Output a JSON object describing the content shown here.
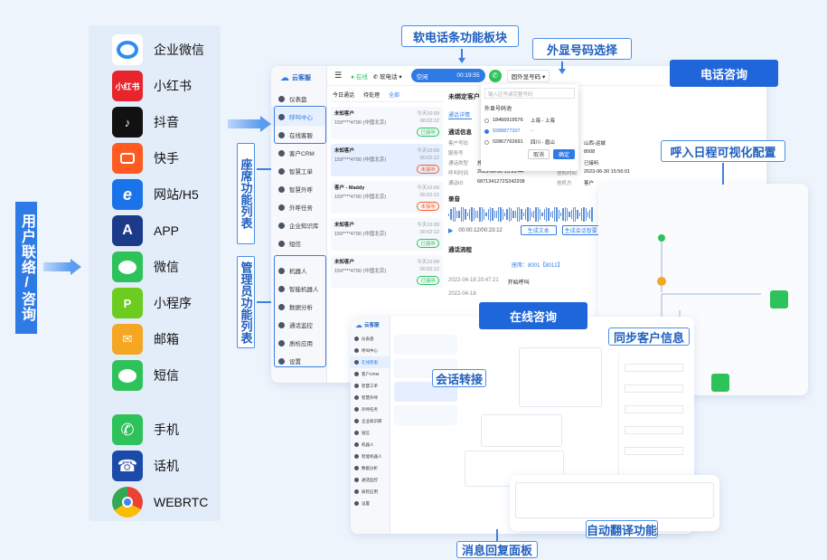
{
  "left_label": "用户联络/咨询",
  "channels": [
    {
      "name": "企业微信",
      "icon": "wecom-icon",
      "color": "#2d8cf0"
    },
    {
      "name": "小红书",
      "icon": "xiaohongshu-icon",
      "color": "#e8242c",
      "icon_text": "小红书"
    },
    {
      "name": "抖音",
      "icon": "douyin-icon",
      "color": "#111111",
      "icon_text": "♪"
    },
    {
      "name": "快手",
      "icon": "kuaishou-icon",
      "color": "#ff5a1f"
    },
    {
      "name": "网站/H5",
      "icon": "browser-e-icon",
      "color": "#1a73e8",
      "icon_text": "e"
    },
    {
      "name": "APP",
      "icon": "app-store-icon",
      "color": "#1b3a8a",
      "icon_text": "A"
    },
    {
      "name": "微信",
      "icon": "wechat-icon",
      "color": "#2ec35a"
    },
    {
      "name": "小程序",
      "icon": "miniprogram-icon",
      "color": "#6ccc1f",
      "icon_text": "P"
    },
    {
      "name": "邮箱",
      "icon": "mail-icon",
      "color": "#f5a623",
      "icon_text": "✉"
    },
    {
      "name": "短信",
      "icon": "sms-icon",
      "color": "#2ec35a"
    },
    {
      "name": "手机",
      "icon": "phone-icon",
      "color": "#2ec35a",
      "icon_text": "✆"
    },
    {
      "name": "话机",
      "icon": "desk-phone-icon",
      "color": "#1b4aa8",
      "icon_text": "☎"
    },
    {
      "name": "WEBRTC",
      "icon": "chrome-icon",
      "color": "#ffffff"
    }
  ],
  "seat_label": "座席功能列表",
  "admin_label": "管理员功能列表",
  "callouts": {
    "softphone": "软电话条功能板块",
    "outbound_number": "外显号码选择",
    "phone_consult": "电话咨询",
    "ivr_config": "呼入日程可视化配置",
    "online_consult": "在线咨询",
    "sync_customer": "同步客户信息",
    "session_transfer": "会话转接",
    "auto_translate": "自动翻译功能",
    "quick_reply": "消息回复面板"
  },
  "app": {
    "logo": "云客服",
    "menu": [
      "仪表盘",
      "呼叫中心",
      "在线客服",
      "客户CRM",
      "智慧工单",
      "智慧外呼",
      "外呼任务",
      "企业知识库",
      "短信",
      "机器人",
      "智能机器人",
      "数据分析",
      "通话监控",
      "质检应用",
      "设置"
    ],
    "status": "空闲",
    "timer": "00:19:55",
    "outbound_select": "固外显号码",
    "online_text": "在线",
    "softphone_text": "软电话",
    "tabs": [
      "今日通话",
      "待处理",
      "全部"
    ],
    "calls": [
      {
        "name": "未知客户",
        "phone": "159****4790 (中国北京)",
        "time": "今天10:09",
        "dur": "00:02:12",
        "tag": "已接听"
      },
      {
        "name": "未知客户",
        "phone": "159****4790 (中国北京)",
        "time": "今天10:09",
        "dur": "00:02:12",
        "tag": "未接听"
      },
      {
        "name": "客户 - Maddy",
        "phone": "159****4790 (中国北京)",
        "time": "今天10:09",
        "dur": "00:02:12",
        "tag": "未接听"
      },
      {
        "name": "未知客户",
        "phone": "159****4790 (中国北京)",
        "time": "今天10:09",
        "dur": "00:02:12",
        "tag": "已接听"
      },
      {
        "name": "未知客户",
        "phone": "159****4790 (中国北京)",
        "time": "今天10:09",
        "dur": "00:02:12",
        "tag": "已接听"
      }
    ],
    "dropdown": {
      "placeholder": "输入区号或完整号码",
      "title": "外显号码池",
      "numbers": [
        {
          "num": "18466919576",
          "loc": "上海 - 上海"
        },
        {
          "num": "9388877307",
          "loc": "--"
        },
        {
          "num": "02867762691",
          "loc": "四川 - 眉山"
        }
      ],
      "cancel": "取消",
      "ok": "确定"
    },
    "detail_title": "未绑定客户",
    "detail_tab": "通话详情",
    "info_title": "通话信息",
    "info_rows": [
      [
        "客户号码",
        ""
      ],
      [
        "服务号",
        ""
      ],
      [
        "通话类型",
        "外呼"
      ],
      [
        "呼叫时间",
        "2023-06-30 15:55:44"
      ],
      [
        "通话ID",
        "6871341272S342208"
      ]
    ],
    "info_right": [
      [
        "",
        "山西-运城"
      ],
      [
        "",
        "8008"
      ],
      [
        "",
        "已接听"
      ],
      [
        "挂机时间",
        "2023-06-30 15:56:01"
      ],
      [
        "挂机方",
        "客户"
      ]
    ],
    "record_label": "录音",
    "record_time": "00:00:12/00:23:12",
    "gen_text": "生成文本",
    "gen_summary": "生成会话智要",
    "flow_label": "通话流程",
    "flow_queue": "座席：8001【8012】",
    "flow_time1": "2022-04-18 20:47:21",
    "flow_event": "开始呼叫",
    "flow_time2": "2022-04-18"
  }
}
